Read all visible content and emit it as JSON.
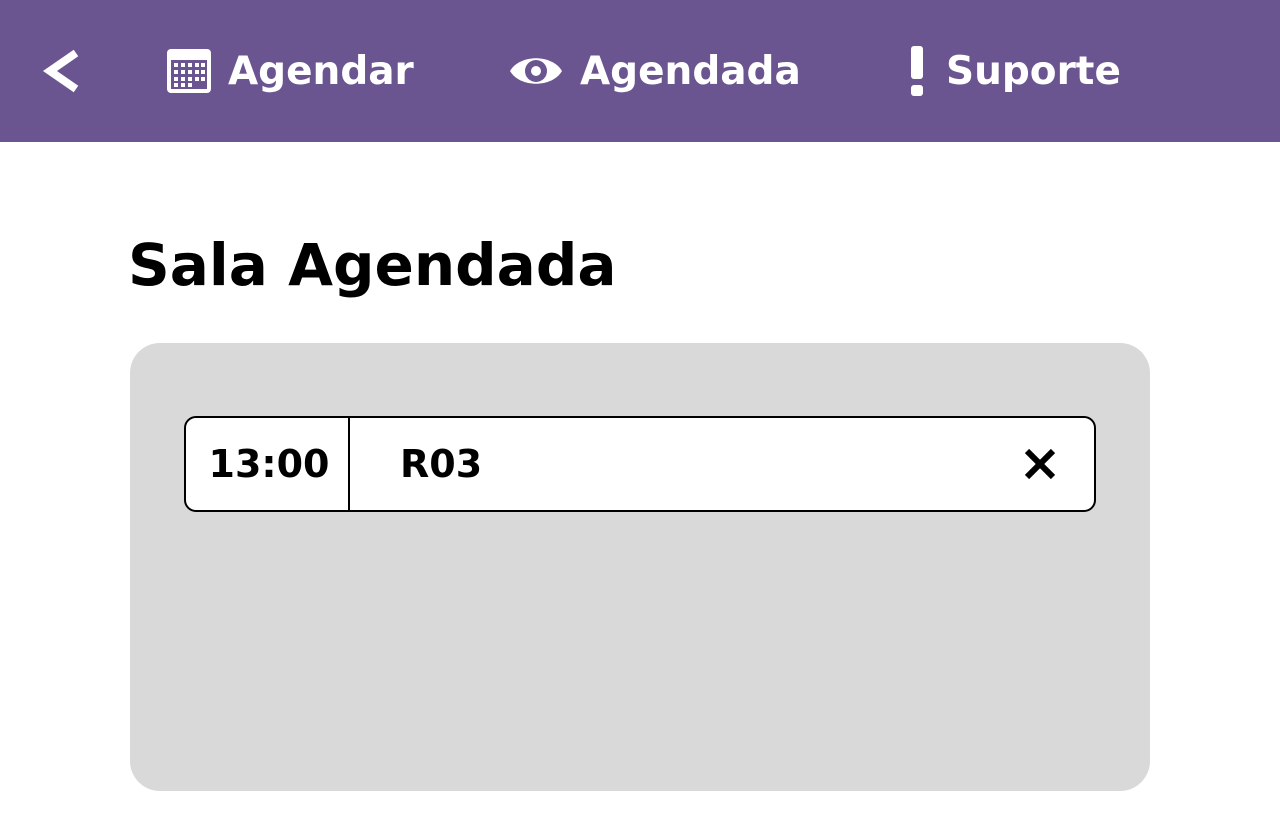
{
  "nav": {
    "back_icon": "chevron-left-icon",
    "items": [
      {
        "label": "Agendar",
        "icon": "calendar-icon"
      },
      {
        "label": "Agendada",
        "icon": "eye-icon"
      },
      {
        "label": "Suporte",
        "icon": "exclamation-icon"
      }
    ]
  },
  "main": {
    "title": "Sala Agendada",
    "bookings": [
      {
        "time": "13:00",
        "room": "R03",
        "action_icon": "close-icon"
      }
    ]
  },
  "colors": {
    "topbar": "#6a5590",
    "panel": "#d9d9d9",
    "row_bg": "#ffffff",
    "text": "#000000",
    "nav_text": "#ffffff"
  }
}
